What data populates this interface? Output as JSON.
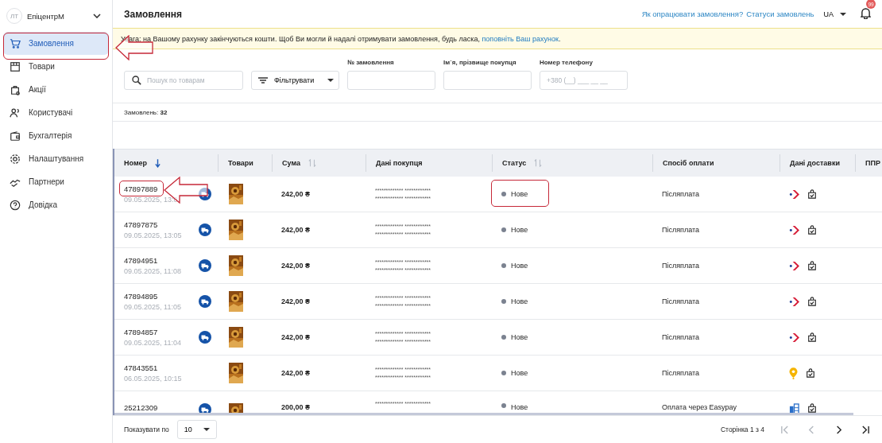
{
  "sidebar": {
    "avatar": "ЛТ",
    "account": "ЕпіцентрМ",
    "items": [
      {
        "label": "Замовлення",
        "kind": "cart",
        "selected": true
      },
      {
        "label": "Товари",
        "kind": "box",
        "selected": false
      },
      {
        "label": "Акції",
        "kind": "bag",
        "selected": false
      },
      {
        "label": "Користувачі",
        "kind": "users",
        "selected": false
      },
      {
        "label": "Бухгалтерія",
        "kind": "wallet",
        "selected": false
      },
      {
        "label": "Налаштування",
        "kind": "gear",
        "selected": false
      },
      {
        "label": "Партнери",
        "kind": "handshake",
        "selected": false
      },
      {
        "label": "Довідка",
        "kind": "help",
        "selected": false
      }
    ]
  },
  "header": {
    "title": "Замовлення",
    "links": [
      "Як опрацювати замовлення?",
      "Статуси замовлень"
    ],
    "language": "UA",
    "notifications": "99"
  },
  "banner": {
    "text": "Увага: на Вашому рахунку закінчуються кошти. Щоб Ви могли й надалі отримувати замовлення, будь ласка, ",
    "link": "поповніть Ваш рахунок",
    "end": "."
  },
  "filters": {
    "search": {
      "placeholder": "Пошук по товарам"
    },
    "filter_button": "Фільтрувати",
    "fields": [
      {
        "label": "№ замовлення"
      },
      {
        "label": "Ім`я, прізвище покупця"
      },
      {
        "label": "Номер телефону",
        "placeholder": "+380 (__) ___ __ __"
      }
    ]
  },
  "count": "Замовлень: **32**",
  "table": {
    "columns": [
      {
        "label": "Номер",
        "kind": "sorted"
      },
      {
        "label": "Товари",
        "kind": "plain"
      },
      {
        "label": "Сума",
        "kind": "sortable"
      },
      {
        "label": "Дані покупця",
        "kind": "plain"
      },
      {
        "label": "Статус",
        "kind": "sortable"
      },
      {
        "label": "Спосіб оплати",
        "kind": "plain"
      },
      {
        "label": "Дані доставки",
        "kind": "plain"
      },
      {
        "label": "ППР",
        "kind": "plain"
      }
    ],
    "rows": [
      {
        "number": "47897889",
        "date": "09.05.2025, 13:0",
        "truck": true,
        "sum": "242,00 ₴",
        "buyer": [
          "************* ************",
          "************* ************"
        ],
        "status": "Нове",
        "payment": "Післяплата",
        "kind": "chevron"
      },
      {
        "number": "47897875",
        "date": "09.05.2025, 13:05",
        "truck": true,
        "sum": "242,00 ₴",
        "buyer": [
          "************* ************",
          "************* ************"
        ],
        "status": "Нове",
        "payment": "Післяплата",
        "kind": "chevron"
      },
      {
        "number": "47894951",
        "date": "09.05.2025, 11:08",
        "truck": true,
        "sum": "242,00 ₴",
        "buyer": [
          "************* ************",
          "************* ************"
        ],
        "status": "Нове",
        "payment": "Післяплата",
        "kind": "chevron"
      },
      {
        "number": "47894895",
        "date": "09.05.2025, 11:05",
        "truck": true,
        "sum": "242,00 ₴",
        "buyer": [
          "************* ************",
          "************* ************"
        ],
        "status": "Нове",
        "payment": "Післяплата",
        "kind": "chevron"
      },
      {
        "number": "47894857",
        "date": "09.05.2025, 11:04",
        "truck": true,
        "sum": "242,00 ₴",
        "buyer": [
          "************* ************",
          "************* ************"
        ],
        "status": "Нове",
        "payment": "Післяплата",
        "kind": "chevron"
      },
      {
        "number": "47843551",
        "date": "06.05.2025, 10:15",
        "truck": false,
        "sum": "242,00 ₴",
        "buyer": [
          "************* ************",
          "************* ************"
        ],
        "status": "Нове",
        "payment": "Післяплата",
        "kind": "pin"
      },
      {
        "number": "25212309",
        "truck": true,
        "sum": "200,00 ₴",
        "buyer": [
          "************* ************"
        ],
        "status": "Нове",
        "payment": "Оплата через Easypay",
        "kind": "post"
      }
    ]
  },
  "footer": {
    "page_size_label": "Показувати по",
    "page_size": "10",
    "page_info": "Сторінка 1 з 4",
    "nav": [
      {
        "disabled": true
      },
      {
        "disabled": true
      },
      {
        "disabled": false
      },
      {
        "disabled": false
      }
    ]
  }
}
